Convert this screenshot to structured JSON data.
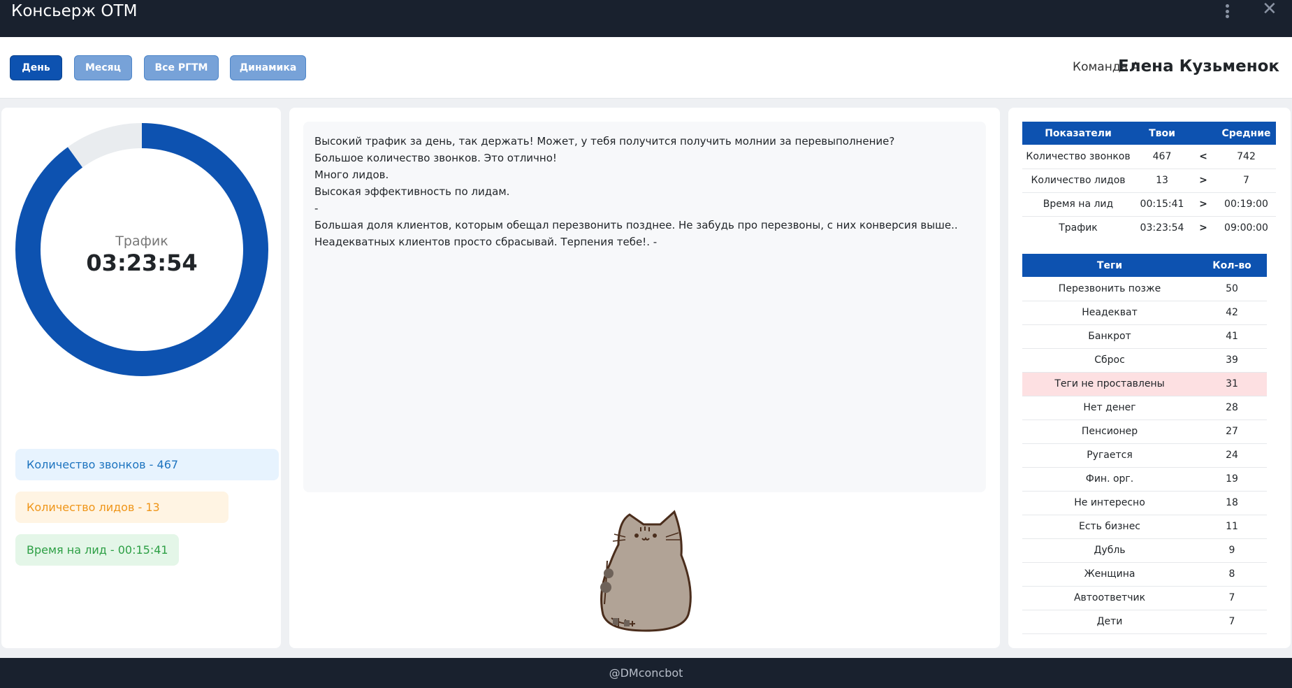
{
  "app": {
    "title": "Консьерж ОТМ"
  },
  "toolbar": {
    "buttons": [
      {
        "label": "День",
        "active": true
      },
      {
        "label": "Месяц",
        "active": false
      },
      {
        "label": "Все РГТМ",
        "active": false
      },
      {
        "label": "Динамика",
        "active": false
      }
    ],
    "team": "Команда А",
    "user_name": "Елена Кузьменок"
  },
  "donut": {
    "label": "Трафик",
    "value": "03:23:54",
    "fill_fraction": 0.9,
    "color": "#0d52b0",
    "track_color": "#e9ecef"
  },
  "stats": {
    "calls": "Количество звонков - 467",
    "leads": "Количество лидов - 13",
    "time_per_lead": "Время на лид - 00:15:41"
  },
  "messages": [
    "Высокий трафик за день, так держать! Может, у тебя получится получить молнии за перевыполнение?",
    "Большое количество звонков. Это отлично!",
    "Много лидов.",
    "Высокая эффективность по лидам.",
    "-",
    "Большая доля клиентов, которым обещал перезвонить позднее. Не забудь про перезвоны, с них конверсия выше..",
    "Неадекватных клиентов просто сбрасывай. Терпения тебе!. -"
  ],
  "metrics_table": {
    "headers": [
      "Показатели",
      "Твои",
      "Средние"
    ],
    "rows": [
      {
        "name": "Количество звонков",
        "mine": "467",
        "sign": "<",
        "avg": "742"
      },
      {
        "name": "Количество лидов",
        "mine": "13",
        "sign": ">",
        "avg": "7"
      },
      {
        "name": "Время на лид",
        "mine": "00:15:41",
        "sign": ">",
        "avg": "00:19:00"
      },
      {
        "name": "Трафик",
        "mine": "03:23:54",
        "sign": ">",
        "avg": "09:00:00"
      }
    ]
  },
  "tags_table": {
    "headers": [
      "Теги",
      "Кол-во"
    ],
    "rows": [
      {
        "tag": "Перезвонить позже",
        "count": "50"
      },
      {
        "tag": "Неадекват",
        "count": "42"
      },
      {
        "tag": "Банкрот",
        "count": "41"
      },
      {
        "tag": "Сброс",
        "count": "39"
      },
      {
        "tag": "Теги не проставлены",
        "count": "31"
      },
      {
        "tag": "Нет денег",
        "count": "28"
      },
      {
        "tag": "Пенсионер",
        "count": "27"
      },
      {
        "tag": "Ругается",
        "count": "24"
      },
      {
        "tag": "Фин. орг.",
        "count": "19"
      },
      {
        "tag": "Не интересно",
        "count": "18"
      },
      {
        "tag": "Есть бизнес",
        "count": "11"
      },
      {
        "tag": "Дубль",
        "count": "9"
      },
      {
        "tag": "Женщина",
        "count": "8"
      },
      {
        "tag": "Автоответчик",
        "count": "7"
      },
      {
        "tag": "Дети",
        "count": "7"
      }
    ]
  },
  "footer": {
    "text": "@DMconcbot"
  },
  "icons": [
    "kebab-menu-icon",
    "close-icon",
    "cat-illustration"
  ]
}
